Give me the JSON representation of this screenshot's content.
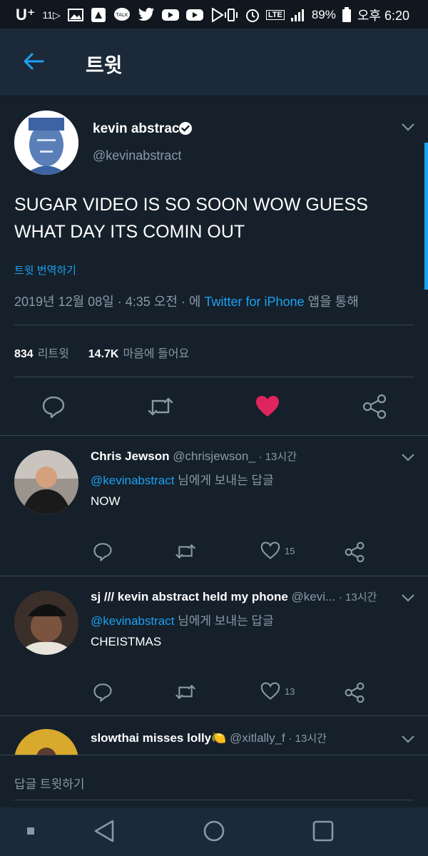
{
  "statusbar": {
    "carrier": "U⁺",
    "carrier_sub": "11▷",
    "battery": "89%",
    "time": "오후 6:20",
    "network": "LTE"
  },
  "header": {
    "title": "트윗"
  },
  "tweet": {
    "name": "kevin abstract",
    "handle": "@kevinabstract",
    "text": "SUGAR VIDEO IS SO SOON WOW GUESS WHAT DAY ITS COMIN OUT",
    "translate": "트윗 번역하기",
    "meta_prefix": "2019년 12월 08일 · 4:35 오전 · 에 ",
    "meta_source": "Twitter for iPhone",
    "meta_suffix": " 앱을 통해",
    "retweets": "834",
    "retweets_label": "리트윗",
    "likes": "14.7K",
    "likes_label": "마음에 들어요"
  },
  "replies": [
    {
      "name": "Chris Jewson",
      "handle": "@chrisjewson_",
      "time": "· 13시간",
      "to_handle": "@kevinabstract",
      "to_suffix": " 님에게 보내는 답글",
      "text": "NOW",
      "likes": "15"
    },
    {
      "name": "sj /// kevin abstract held my phone",
      "handle": "@kevi...",
      "time": "· 13시간",
      "to_handle": "@kevinabstract",
      "to_suffix": " 님에게 보내는 답글",
      "text": "CHEISTMAS",
      "likes": "13"
    },
    {
      "name": "slowthai misses lolly🍋",
      "handle": "@xitlally_f",
      "time": "· 13시간"
    }
  ],
  "compose": {
    "placeholder": "답글 트윗하기"
  },
  "colors": {
    "background": "#15202b",
    "accent": "#1da1f2",
    "like": "#e0245e",
    "muted": "#8899a6"
  }
}
